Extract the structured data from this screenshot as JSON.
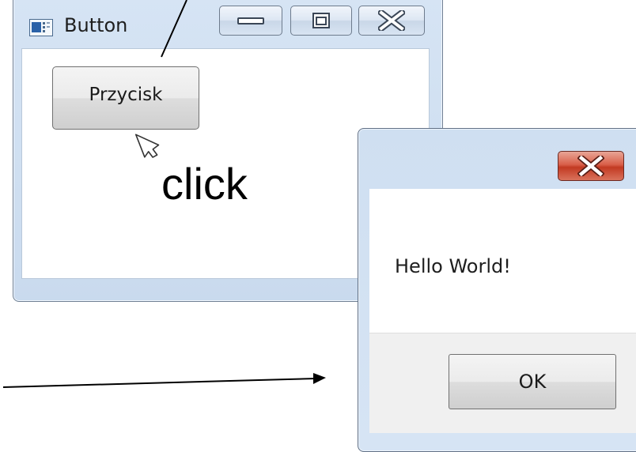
{
  "main_window": {
    "title": "Button",
    "icon": "window-app-icon",
    "controls": [
      "minimize-icon",
      "maximize-icon",
      "close-icon"
    ],
    "button_label": "Przycisk"
  },
  "annotation": {
    "click_label": "click",
    "cursor_icon": "mouse-pointer-icon"
  },
  "dialog": {
    "message": "Hello World!",
    "ok_label": "OK",
    "close_icon": "close-icon",
    "close_color": "#c8452e"
  }
}
